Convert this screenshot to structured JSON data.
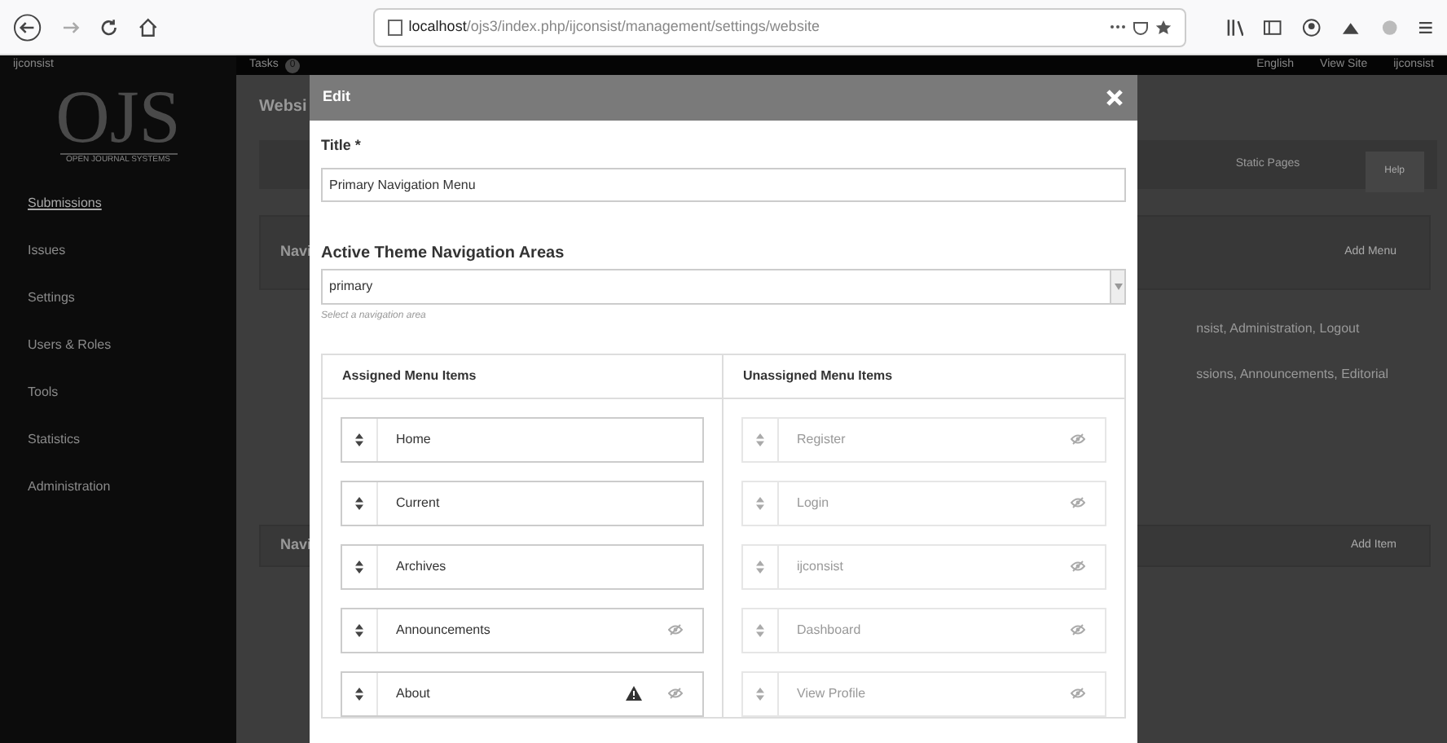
{
  "browser": {
    "url_host": "localhost",
    "url_path": "/ojs3/index.php/ijconsist/management/settings/website"
  },
  "app_header": {
    "journal": "ijconsist",
    "tasks": "Tasks",
    "tasks_count": "0",
    "language": "English",
    "view_site": "View Site",
    "user": "ijconsist"
  },
  "sidebar": {
    "logo": "OJS",
    "logo_tagline": "OPEN JOURNAL SYSTEMS",
    "items": [
      {
        "label": "Submissions",
        "selected": true
      },
      {
        "label": "Issues",
        "selected": false
      },
      {
        "label": "Settings",
        "selected": false
      },
      {
        "label": "Users & Roles",
        "selected": false
      },
      {
        "label": "Tools",
        "selected": false
      },
      {
        "label": "Statistics",
        "selected": false
      },
      {
        "label": "Administration",
        "selected": false
      }
    ]
  },
  "background": {
    "page_title": "Websi",
    "tab": "Static Pages",
    "help": "Help",
    "menus_heading": "Navi",
    "add_menu": "Add Menu",
    "menu_lines": [
      "nsist, Administration, Logout",
      "ssions, Announcements, Editorial"
    ],
    "items_heading": "Navi",
    "add_item": "Add Item"
  },
  "modal": {
    "title": "Edit",
    "title_label": "Title *",
    "title_value": "Primary Navigation Menu",
    "area_label": "Active Theme Navigation Areas",
    "area_value": "primary",
    "area_hint": "Select a navigation area",
    "assigned_heading": "Assigned Menu Items",
    "unassigned_heading": "Unassigned Menu Items",
    "assigned": [
      {
        "label": "Home",
        "hidden": false,
        "warning": false
      },
      {
        "label": "Current",
        "hidden": false,
        "warning": false
      },
      {
        "label": "Archives",
        "hidden": false,
        "warning": false
      },
      {
        "label": "Announcements",
        "hidden": true,
        "warning": false
      },
      {
        "label": "About",
        "hidden": true,
        "warning": true
      }
    ],
    "unassigned": [
      {
        "label": "Register",
        "hidden": true,
        "warning": false
      },
      {
        "label": "Login",
        "hidden": true,
        "warning": false
      },
      {
        "label": "ijconsist",
        "hidden": true,
        "warning": false
      },
      {
        "label": "Dashboard",
        "hidden": true,
        "warning": false
      },
      {
        "label": "View Profile",
        "hidden": true,
        "warning": false
      }
    ]
  }
}
